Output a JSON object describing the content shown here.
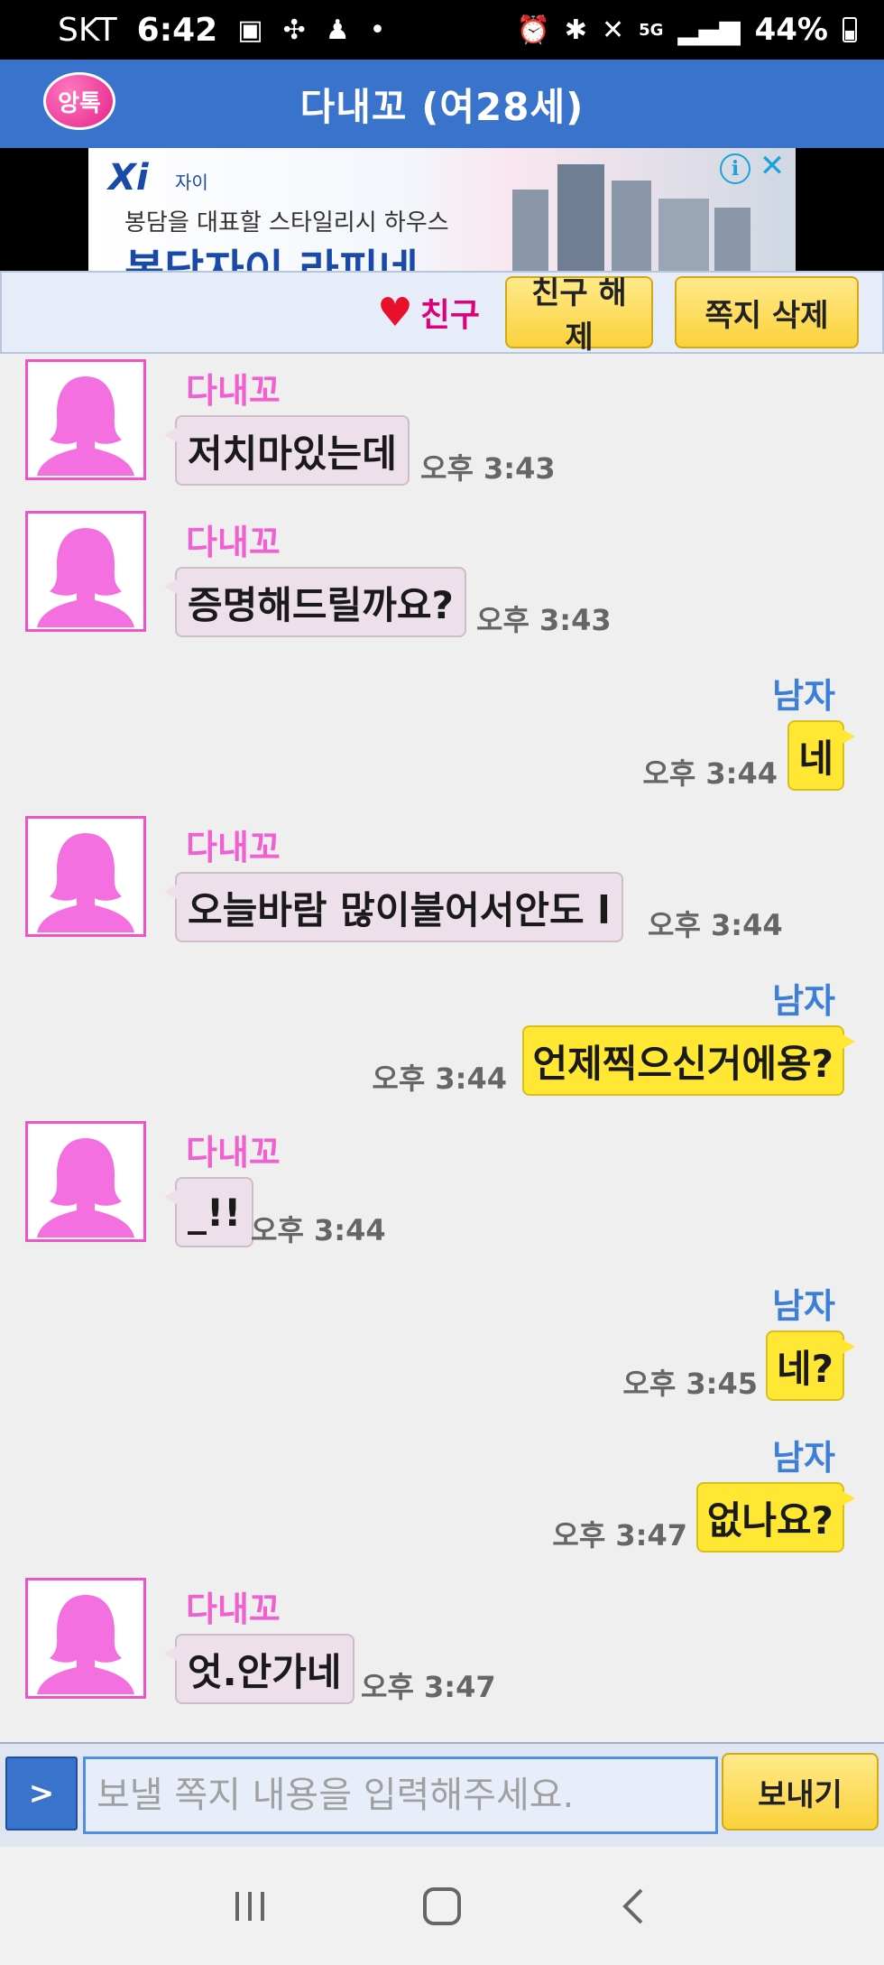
{
  "status_bar": {
    "carrier": "SKT",
    "time": "6:42",
    "network": "5G",
    "battery": "44%"
  },
  "header": {
    "logo_text": "앙톡",
    "title": "다내꼬 (여28세)"
  },
  "ad": {
    "brand": "Xi",
    "brand_sub": "자이",
    "subtitle": "봉담을 대표할 스타일리시 하우스",
    "headline": "봉담자이 라피네"
  },
  "action_bar": {
    "friend_label": "친구",
    "unfriend_label": "친구 해제",
    "delete_label": "쪽지 삭제"
  },
  "messages": [
    {
      "sender": "다내꼬",
      "text": "저치마있는데",
      "time": "오후 3:43"
    },
    {
      "sender": "다내꼬",
      "text": "증명해드릴까요?",
      "time": "오후 3:43"
    },
    {
      "sender": "남자",
      "text": "네",
      "time": "오후 3:44"
    },
    {
      "sender": "다내꼬",
      "text": "오늘바람 많이불어서안도 l",
      "time": "오후 3:44"
    },
    {
      "sender": "남자",
      "text": "언제찍으신거에용?",
      "time": "오후 3:44"
    },
    {
      "sender": "다내꼬",
      "text": "_!!",
      "time": "오후 3:44"
    },
    {
      "sender": "남자",
      "text": "네?",
      "time": "오후 3:45"
    },
    {
      "sender": "남자",
      "text": "없나요?",
      "time": "오후 3:47"
    },
    {
      "sender": "다내꼬",
      "text": "엇.안가네",
      "time": "오후 3:47"
    }
  ],
  "input_bar": {
    "expand_label": ">",
    "placeholder": "보낼 쪽지 내용을 입력해주세요.",
    "value": "",
    "send_label": "보내기"
  },
  "colors": {
    "header_bg": "#3a73cc",
    "female_name": "#f060d0",
    "male_name": "#3c7ed8",
    "incoming_bubble": "#ede0ea",
    "outgoing_bubble": "#ffe733",
    "button_yellow": "#fbd23b"
  }
}
